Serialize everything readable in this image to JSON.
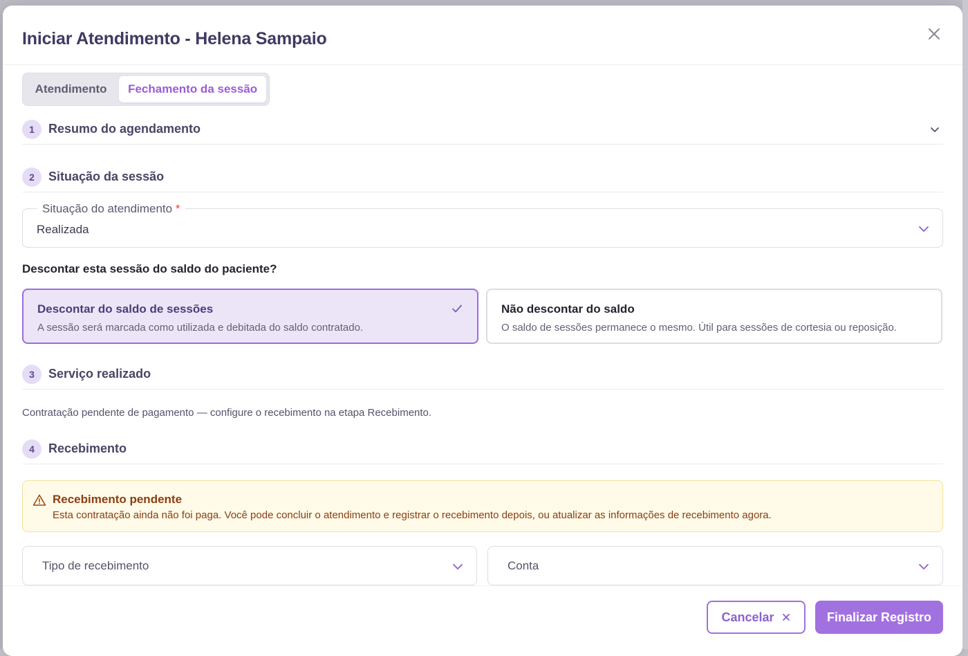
{
  "modal": {
    "title": "Iniciar Atendimento - Helena Sampaio"
  },
  "tabs": [
    {
      "label": "Atendimento",
      "active": false
    },
    {
      "label": "Fechamento da sessão",
      "active": true
    }
  ],
  "sections": [
    {
      "number": "1",
      "title": "Resumo do agendamento"
    },
    {
      "number": "2",
      "title": "Situação da sessão"
    },
    {
      "number": "3",
      "title": "Serviço realizado"
    },
    {
      "number": "4",
      "title": "Recebimento"
    }
  ],
  "session_status": {
    "label": "Situação do atendimento",
    "required_mark": "*",
    "value": "Realizada"
  },
  "discount": {
    "question": "Descontar esta sessão do saldo do paciente?",
    "options": [
      {
        "title": "Descontar do saldo de sessões",
        "description": "A sessão será marcada como utilizada e debitada do saldo contratado.",
        "selected": true
      },
      {
        "title": "Não descontar do saldo",
        "description": "O saldo de sessões permanece o mesmo. Útil para sessões de cortesia ou reposição.",
        "selected": false
      }
    ]
  },
  "service": {
    "info": "Contratação pendente de pagamento — configure o recebimento na etapa Recebimento."
  },
  "payment": {
    "alert_title": "Recebimento pendente",
    "alert_text": "Esta contratação ainda não foi paga. Você pode concluir o atendimento e registrar o recebimento depois, ou atualizar as informações de recebimento agora.",
    "type_placeholder": "Tipo de recebimento",
    "account_placeholder": "Conta"
  },
  "footer": {
    "cancel_label": "Cancelar",
    "finish_label": "Finalizar Registro"
  },
  "colors": {
    "accent": "#a271e0",
    "title": "#3f3a63",
    "warning_bg": "#fffbe8",
    "warning_text": "#8a3e12"
  }
}
